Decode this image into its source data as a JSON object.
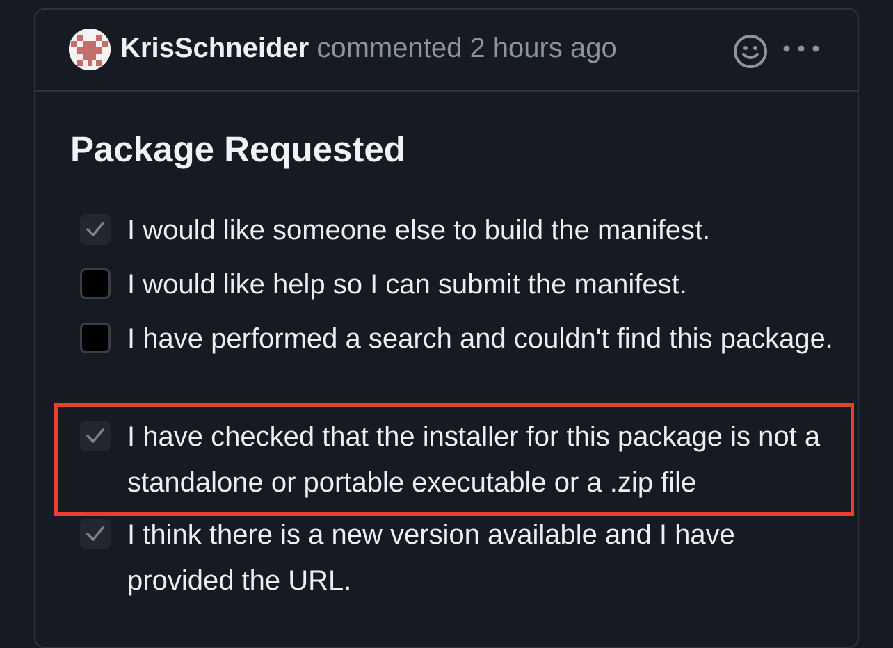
{
  "comment": {
    "author": "KrisSchneider",
    "meta": "commented 2 hours ago",
    "icons": {
      "avatar": "identicon-avatar",
      "reaction": "smiley-icon",
      "more": "kebab-horizontal-icon"
    }
  },
  "body": {
    "title": "Package Requested",
    "tasks": [
      {
        "label": "I would like someone else to build the manifest.",
        "checked": true
      },
      {
        "label": "I would like help so I can submit the manifest.",
        "checked": false
      },
      {
        "label": "I have performed a search and couldn't find this package.",
        "checked": false
      },
      {
        "label": "I have checked that the installer for this package is not a standalone or portable executable or a .zip file",
        "checked": true
      },
      {
        "label": "I think there is a new version available and I have provided the URL.",
        "checked": true
      }
    ]
  },
  "colors": {
    "background": "#161a22",
    "border": "#2f343c",
    "highlight": "#e5412f",
    "avatar_pattern": "#c46d6d"
  }
}
